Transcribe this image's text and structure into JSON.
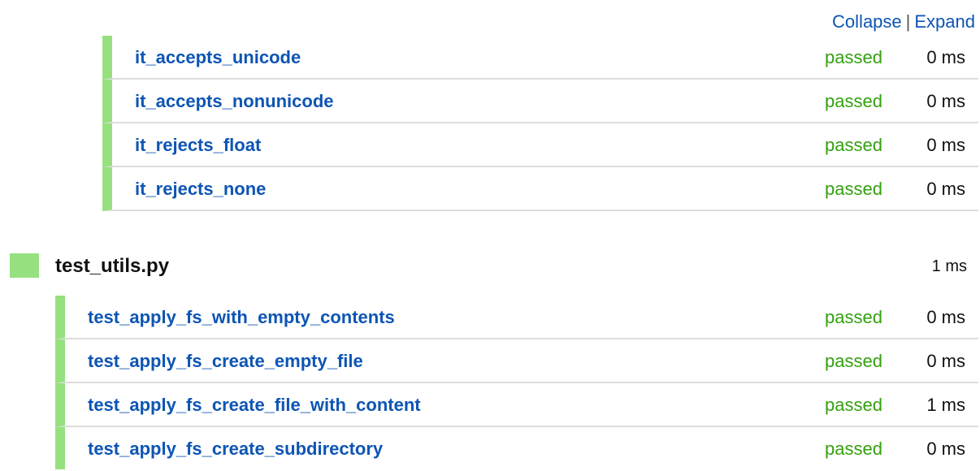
{
  "toolbar": {
    "collapse_label": "Collapse",
    "separator": "|",
    "expand_label": "Expand"
  },
  "group_1": {
    "tests": [
      {
        "name": "it_accepts_unicode",
        "status": "passed",
        "duration": "0 ms"
      },
      {
        "name": "it_accepts_nonunicode",
        "status": "passed",
        "duration": "0 ms"
      },
      {
        "name": "it_rejects_float",
        "status": "passed",
        "duration": "0 ms"
      },
      {
        "name": "it_rejects_none",
        "status": "passed",
        "duration": "0 ms"
      }
    ]
  },
  "file": {
    "name": "test_utils.py",
    "duration": "1 ms",
    "tests": [
      {
        "name": "test_apply_fs_with_empty_contents",
        "status": "passed",
        "duration": "0 ms"
      },
      {
        "name": "test_apply_fs_create_empty_file",
        "status": "passed",
        "duration": "0 ms"
      },
      {
        "name": "test_apply_fs_create_file_with_content",
        "status": "passed",
        "duration": "1 ms"
      },
      {
        "name": "test_apply_fs_create_subdirectory",
        "status": "passed",
        "duration": "0 ms"
      }
    ]
  },
  "colors": {
    "link": "#0d55b4",
    "passed": "#33a00f",
    "status_bar": "#97e07f",
    "divider": "#dddddd"
  }
}
